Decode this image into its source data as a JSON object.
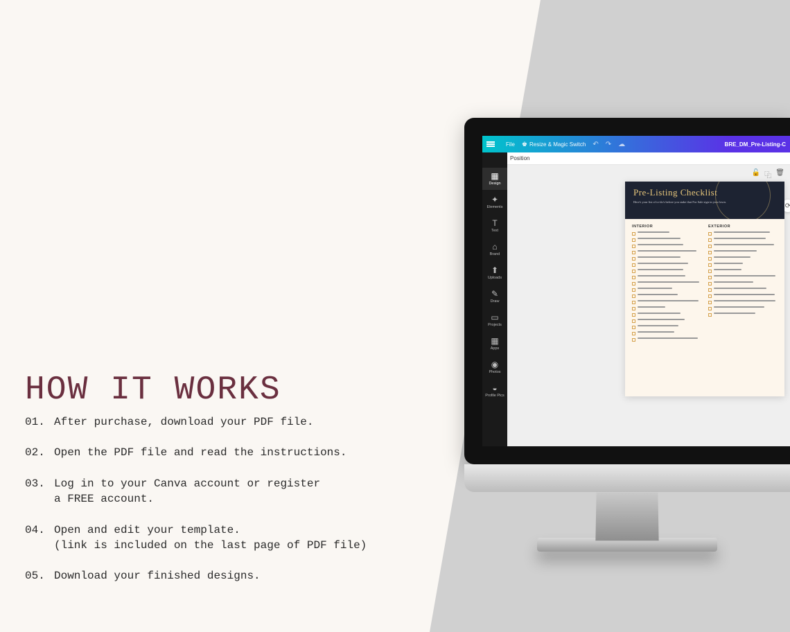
{
  "heading": "HOW IT WORKS",
  "steps": [
    {
      "num": "01.",
      "text": "After purchase, download your PDF file."
    },
    {
      "num": "02.",
      "text": "Open the PDF file and read the instructions."
    },
    {
      "num": "03.",
      "text": "Log in to your Canva account or register",
      "text2": "a FREE account."
    },
    {
      "num": "04.",
      "text": "Open and edit your template.",
      "text2": "(link is included on the last page of PDF file)"
    },
    {
      "num": "05.",
      "text": "Download your finished designs."
    }
  ],
  "canva": {
    "file": "File",
    "resize": "Resize & Magic Switch",
    "docTitle": "BRE_DM_Pre-Listing-C",
    "position": "Position",
    "sidebar": [
      "Design",
      "Elements",
      "Text",
      "Brand",
      "Uploads",
      "Draw",
      "Projects",
      "Apps",
      "Photos",
      "Profile Pics"
    ]
  },
  "doc": {
    "title": "Pre-Listing Checklist",
    "sub": "Here's your list of to-do's before you stake that For Sale sign in your lawn.",
    "left": "INTERIOR",
    "right": "EXTERIOR"
  }
}
